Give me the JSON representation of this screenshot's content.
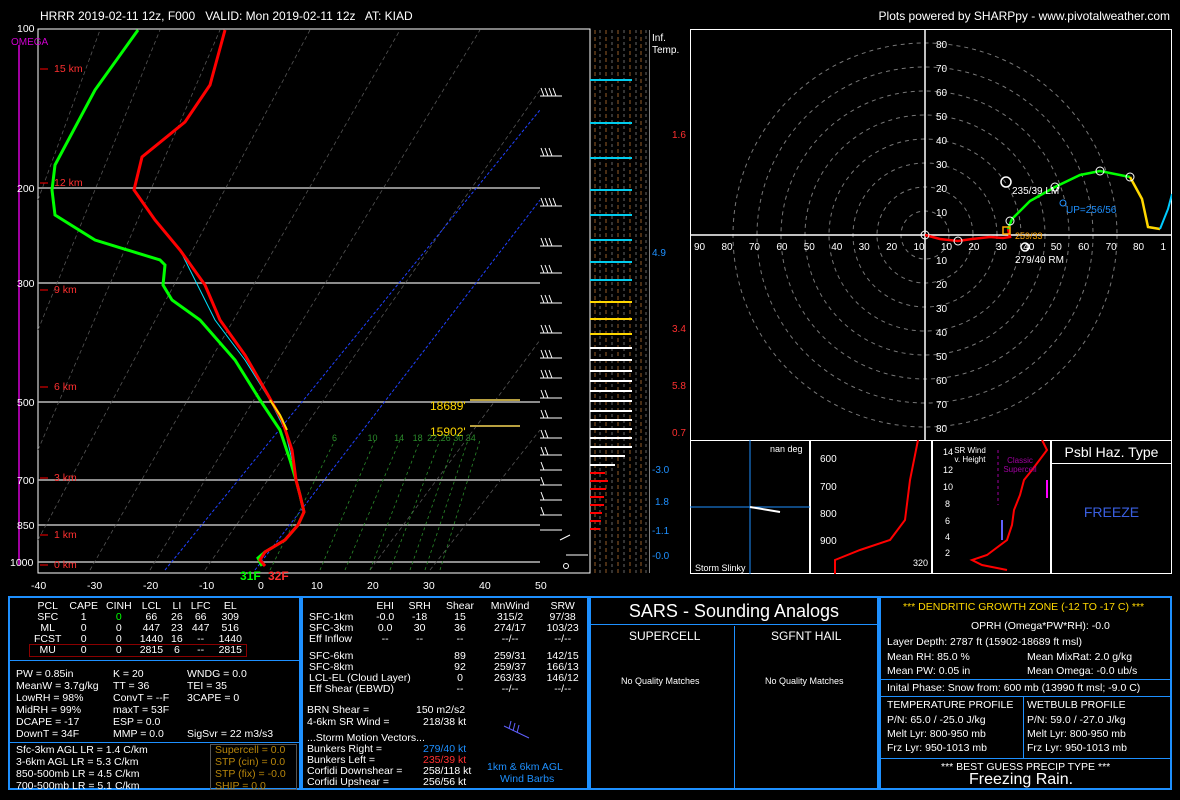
{
  "header": {
    "left": "HRRR 2019-02-11 12z, F000   VALID: Mon 2019-02-11 12z   AT: KIAD",
    "right": "Plots powered by SHARPpy - www.pivotalweather.com"
  },
  "skewt": {
    "omega_label": "OMEGA",
    "pressure_labels": [
      "100",
      "200",
      "300",
      "500",
      "700",
      "850",
      "1000"
    ],
    "height_labels": [
      "15 km",
      "12 km",
      "9 km",
      "6 km",
      "3 km",
      "1 km",
      "0 km"
    ],
    "temp_ticks": [
      "-40",
      "-30",
      "-20",
      "-10",
      "0",
      "10",
      "20",
      "30",
      "40",
      "50"
    ],
    "dgz_top": "18689'",
    "dgz_bottom": "15902'",
    "mix_ratio_labels": [
      "6",
      "10",
      "14",
      "18",
      "22",
      "26",
      "30",
      "34"
    ],
    "sfc_temp": "31F",
    "sfc_dew_f": "32F",
    "colors": {
      "temp": "#ff0000",
      "dewp": "#00ff00",
      "wetbulb": "#00ffff",
      "isobar": "#c0c0c0"
    }
  },
  "chart_data": {
    "type": "line",
    "title": "",
    "xlabel": "",
    "ylabel": "",
    "xlim": [
      -40,
      50
    ],
    "y_scale": "log-pressure",
    "ylim": [
      1000,
      100
    ],
    "series": []
  },
  "inflow": {
    "title_line1": "Inf.",
    "title_line2": "Temp.",
    "values": [
      "1.6",
      "4.9",
      "3.4",
      "5.8",
      "0.7",
      "-3.0",
      "1.8",
      "-1.1",
      "-0.0"
    ]
  },
  "hodograph": {
    "rings": [
      "80",
      "70",
      "60",
      "50",
      "40",
      "30",
      "20",
      "10"
    ],
    "x_ticks": [
      "90",
      "80",
      "70",
      "60",
      "50",
      "40",
      "30",
      "20",
      "10",
      "10",
      "20",
      "30",
      "40",
      "50",
      "60",
      "70",
      "80",
      "1"
    ],
    "labels": {
      "lm": "235/39 LM",
      "up": "UP=256/56",
      "rm": "279/40 RM",
      "mean": "259/33"
    }
  },
  "storm_slinky": {
    "title": "Storm Slinky",
    "deg": "nan deg",
    "levels": [
      "600",
      "700",
      "800",
      "900"
    ]
  },
  "sr_wind": {
    "title": "SR Wind v. Height",
    "heights": [
      "14",
      "12",
      "10",
      "8",
      "6",
      "4",
      "2"
    ],
    "classic": "Classic Supercell",
    "value": "320"
  },
  "hazard": {
    "title": "Psbl Haz. Type",
    "value": "FREEZE"
  },
  "parcels": {
    "headers": [
      "PCL",
      "CAPE",
      "CINH",
      "LCL",
      "LI",
      "LFC",
      "EL"
    ],
    "rows": [
      [
        "SFC",
        "1",
        "0",
        "66",
        "26",
        "66",
        "309"
      ],
      [
        "ML",
        "0",
        "0",
        "447",
        "23",
        "447",
        "516"
      ],
      [
        "FCST",
        "0",
        "0",
        "1440",
        "16",
        "--",
        "1440"
      ],
      [
        "MU",
        "0",
        "0",
        "2815",
        "6",
        "--",
        "2815"
      ]
    ]
  },
  "indices": {
    "col1": [
      "PW = 0.85in",
      "MeanW = 3.7g/kg",
      "LowRH = 98%",
      "MidRH = 99%",
      "DCAPE = -17",
      "DownT = 34F"
    ],
    "col2": [
      "K = 20",
      "TT = 36",
      "ConvT = --F",
      "maxT = 53F",
      "ESP = 0.0",
      "MMP = 0.0"
    ],
    "col3": [
      "WNDG = 0.0",
      "TEI = 35",
      "3CAPE = 0",
      "",
      "",
      ""
    ],
    "sigsvr": "SigSvr = 22 m3/s3",
    "lapse": [
      "Sfc-3km AGL LR = 1.4 C/km",
      "3-6km AGL LR = 5.3 C/km",
      "850-500mb LR = 4.5 C/km",
      "700-500mb LR = 5.1 C/km"
    ],
    "composite": [
      "Supercell = 0.0",
      "STP (cin) = 0.0",
      "STP (fix) = -0.0",
      "SHIP = 0.0"
    ]
  },
  "kinematics": {
    "headers": [
      "",
      "EHI",
      "SRH",
      "Shear",
      "MnWind",
      "SRW"
    ],
    "rows": [
      [
        "SFC-1km",
        "-0.0",
        "-18",
        "15",
        "315/2",
        "97/38"
      ],
      [
        "SFC-3km",
        "0.0",
        "30",
        "36",
        "274/17",
        "103/23"
      ],
      [
        "Eff Inflow",
        "--",
        "--",
        "--",
        "--/--",
        "--/--"
      ]
    ],
    "rows2": [
      [
        "SFC-6km",
        "",
        "",
        "89",
        "259/31",
        "142/15"
      ],
      [
        "SFC-8km",
        "",
        "",
        "92",
        "259/37",
        "166/13"
      ],
      [
        "LCL-EL (Cloud Layer)",
        "",
        "",
        "0",
        "263/33",
        "146/12"
      ],
      [
        "Eff Shear (EBWD)",
        "",
        "",
        "--",
        "--/--",
        "--/--"
      ]
    ],
    "brn_shear": "BRN Shear =",
    "brn_val": "150 m2/s2",
    "sr_wind": "4-6km SR Wind =",
    "sr_wind_val": "218/38 kt",
    "sm_title": "...Storm Motion Vectors...",
    "sm": [
      [
        "Bunkers Right =",
        "279/40 kt"
      ],
      [
        "Bunkers Left =",
        "235/39 kt"
      ],
      [
        "Corfidi Downshear =",
        "258/118 kt"
      ],
      [
        "Corfidi Upshear =",
        "256/56 kt"
      ]
    ],
    "barbs_label1": "1km & 6km AGL",
    "barbs_label2": "Wind Barbs"
  },
  "sars": {
    "title": "SARS - Sounding Analogs",
    "supercell": "SUPERCELL",
    "hail": "SGFNT HAIL",
    "sup_match": "No Quality Matches",
    "hail_match": "No Quality Matches"
  },
  "dgz": {
    "title": "*** DENDRITIC GROWTH ZONE (-12 TO -17 C) ***",
    "oprh": "OPRH (Omega*PW*RH): -0.0",
    "left": [
      "Layer Depth: 2787 ft (15902-18689 ft msl)",
      "Mean RH: 85.0 %",
      "Mean PW: 0.05 in"
    ],
    "right": [
      "Mean MixRat: 2.0 g/kg",
      "Mean Omega: -0.0 ub/s"
    ],
    "initial_phase": "Inital Phase: Snow from: 600 mb (13990 ft msl; -9.0 C)",
    "temp_title": "TEMPERATURE PROFILE",
    "temp": [
      "P/N: 65.0 / -25.0 J/kg",
      "Melt Lyr: 800-950 mb",
      "Frz Lyr: 950-1013 mb"
    ],
    "wb_title": "WETBULB PROFILE",
    "wb": [
      "P/N: 59.0 / -27.0 J/kg",
      "Melt Lyr: 800-950 mb",
      "Frz Lyr: 950-1013 mb"
    ],
    "precip_title": "*** BEST GUESS PRECIP TYPE ***",
    "precip": "Freezing Rain."
  }
}
